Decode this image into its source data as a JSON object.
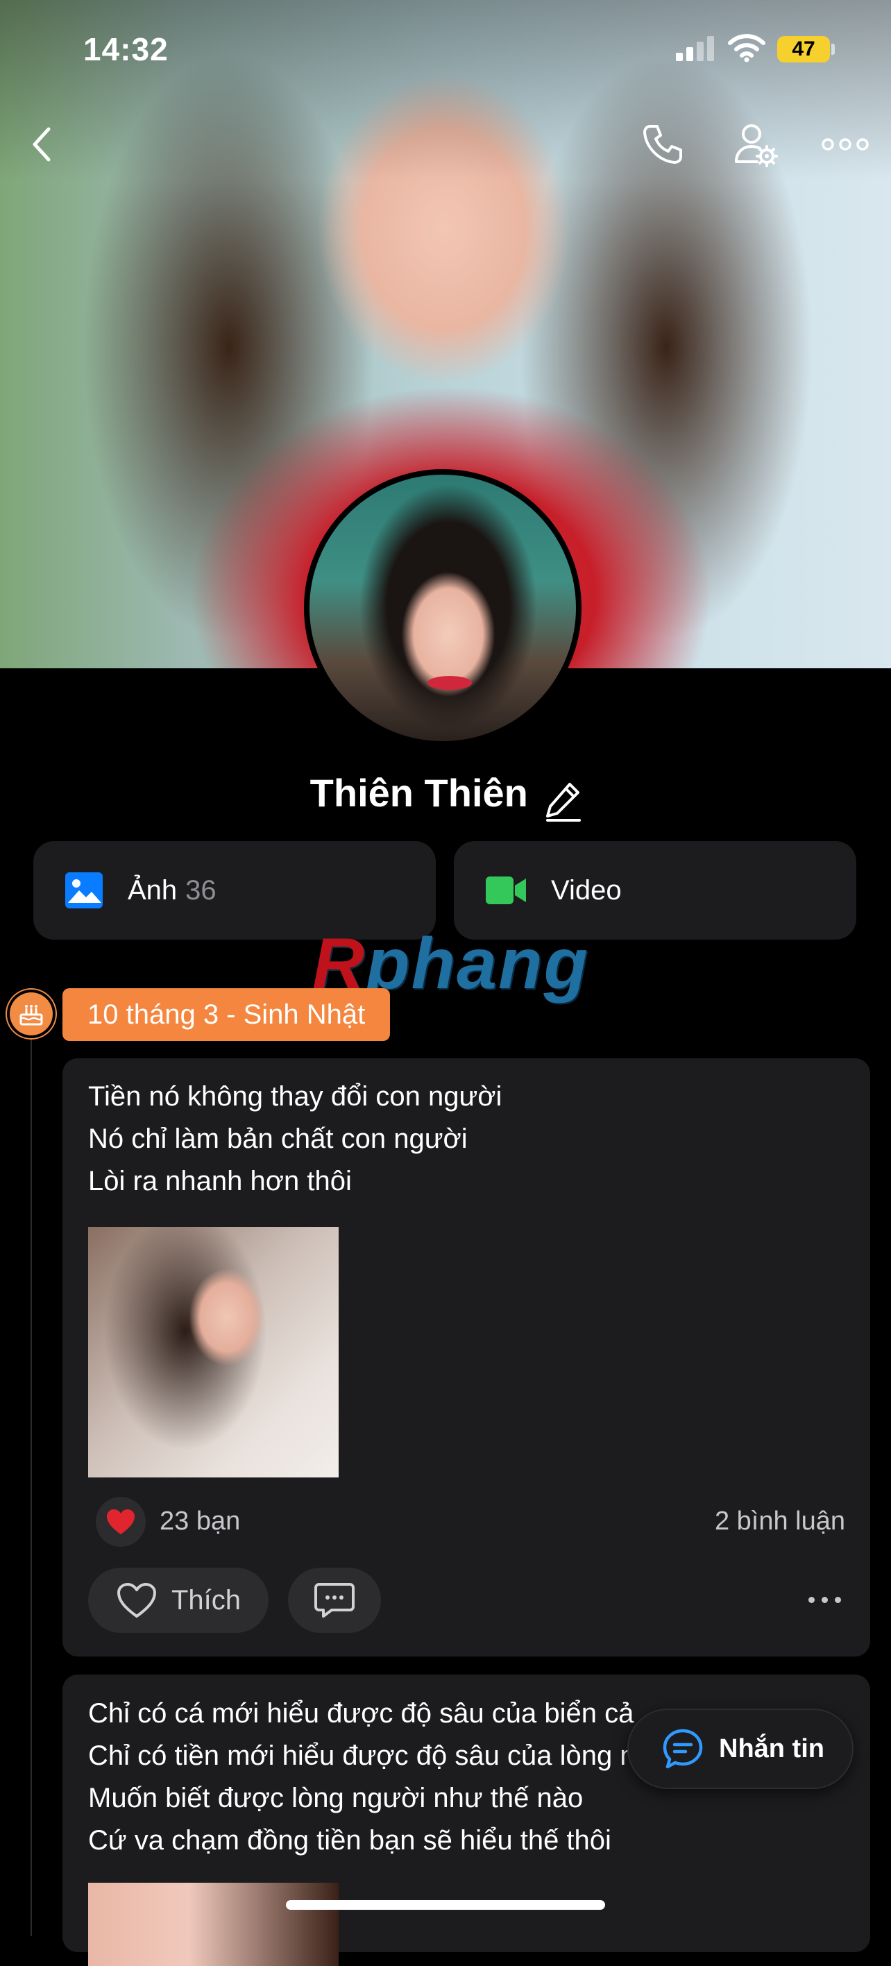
{
  "status_bar": {
    "time": "14:32",
    "battery": "47"
  },
  "profile": {
    "name": "Thiên Thiên"
  },
  "media": {
    "photos_label": "Ảnh",
    "photos_count": "36",
    "video_label": "Video"
  },
  "watermark": {
    "part1": "R",
    "part2": "phang"
  },
  "timeline": {
    "birthday_label": "10 tháng 3 - Sinh Nhật"
  },
  "posts": [
    {
      "text": "Tiền nó không thay đổi  con người\nNó chỉ làm bản chất con người\nLòi ra nhanh hơn thôi",
      "reactions": "23 bạn",
      "comments": "2 bình luận",
      "like_label": "Thích"
    },
    {
      "text": "Chỉ có cá mới hiểu được độ sâu của biển cả\nChỉ có tiền mới hiểu được độ sâu của lòng người\nMuốn biết được lòng người như thế nào\nCứ va chạm  đồng tiền bạn sẽ hiểu thế thôi"
    }
  ],
  "message_button": {
    "label": "Nhắn tin"
  },
  "icons": {
    "back": "chevron-left-icon",
    "call": "phone-icon",
    "settings": "user-settings-icon",
    "more": "more-icon",
    "edit": "pencil-icon",
    "photo": "image-icon",
    "video": "video-camera-icon",
    "birthday": "cake-icon",
    "heart": "heart-icon",
    "comment": "comment-icon",
    "message": "chat-icon"
  },
  "colors": {
    "accent_orange": "#f5863f",
    "photo_blue": "#0a7cff",
    "video_green": "#34c759",
    "heart_red": "#e0252f",
    "battery_yellow": "#f6d02c"
  }
}
